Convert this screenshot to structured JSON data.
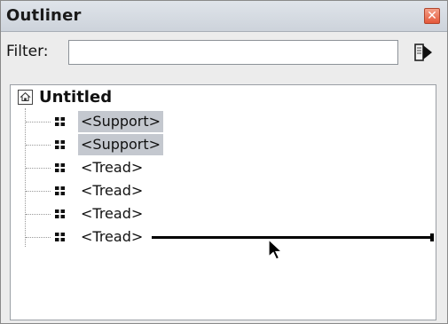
{
  "window": {
    "title": "Outliner",
    "close_glyph": "✕"
  },
  "filter": {
    "label": "Filter:",
    "value": "",
    "placeholder": "",
    "go_icon": "filter-apply-icon"
  },
  "tree": {
    "root": {
      "label": "Untitled",
      "icon": "scene-home-icon"
    },
    "children": [
      {
        "label": "<Support>",
        "selected": true
      },
      {
        "label": "<Support>",
        "selected": true
      },
      {
        "label": "<Tread>",
        "selected": false
      },
      {
        "label": "<Tread>",
        "selected": false
      },
      {
        "label": "<Tread>",
        "selected": false
      },
      {
        "label": "<Tread>",
        "selected": false
      }
    ],
    "node_icon": "node-icon"
  },
  "colors": {
    "selection": "#c4c8cf",
    "close_button": "#e5583a",
    "titlebar": "#d6dbe2"
  }
}
